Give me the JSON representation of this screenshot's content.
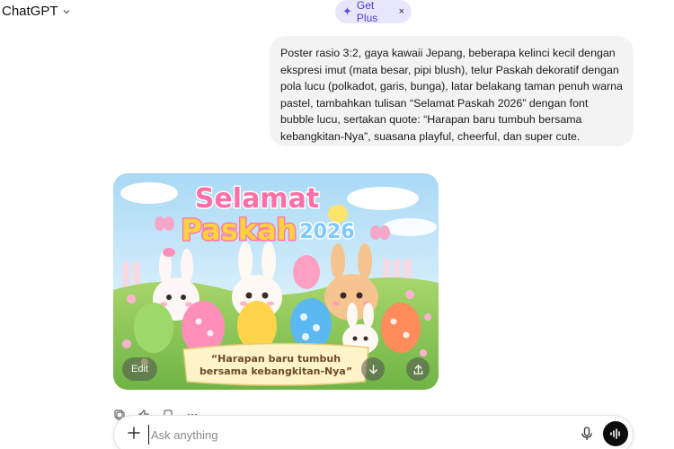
{
  "header": {
    "model_name": "ChatGPT",
    "get_plus_label": "Get Plus",
    "close_glyph": "×"
  },
  "user_message": {
    "text": "Poster rasio 3:2, gaya kawaii Jepang, beberapa kelinci kecil dengan ekspresi imut (mata besar, pipi blush), telur Paskah dekoratif dengan pola lucu (polkadot, garis, bunga), latar belakang taman penuh warna pastel, tambahkan tulisan “Selamat Paskah 2026” dengan font bubble lucu, sertakan quote: “Harapan baru tumbuh bersama kebangkitan-Nya”, suasana playful, cheerful, dan super cute."
  },
  "generated_image": {
    "title_line1": "Selamat",
    "title_line2": "Paskah",
    "year": "2026",
    "quote_line1": "“Harapan baru tumbuh",
    "quote_line2": "bersama kebangkitan-Nya”",
    "edit_label": "Edit"
  },
  "composer": {
    "placeholder": "Ask anything"
  },
  "colors": {
    "accent_plus_bg": "#e8e6fb",
    "accent_plus_text": "#4a3fd0",
    "bubble_bg": "#f3f3f3",
    "voice_button": "#0d0d0d"
  }
}
